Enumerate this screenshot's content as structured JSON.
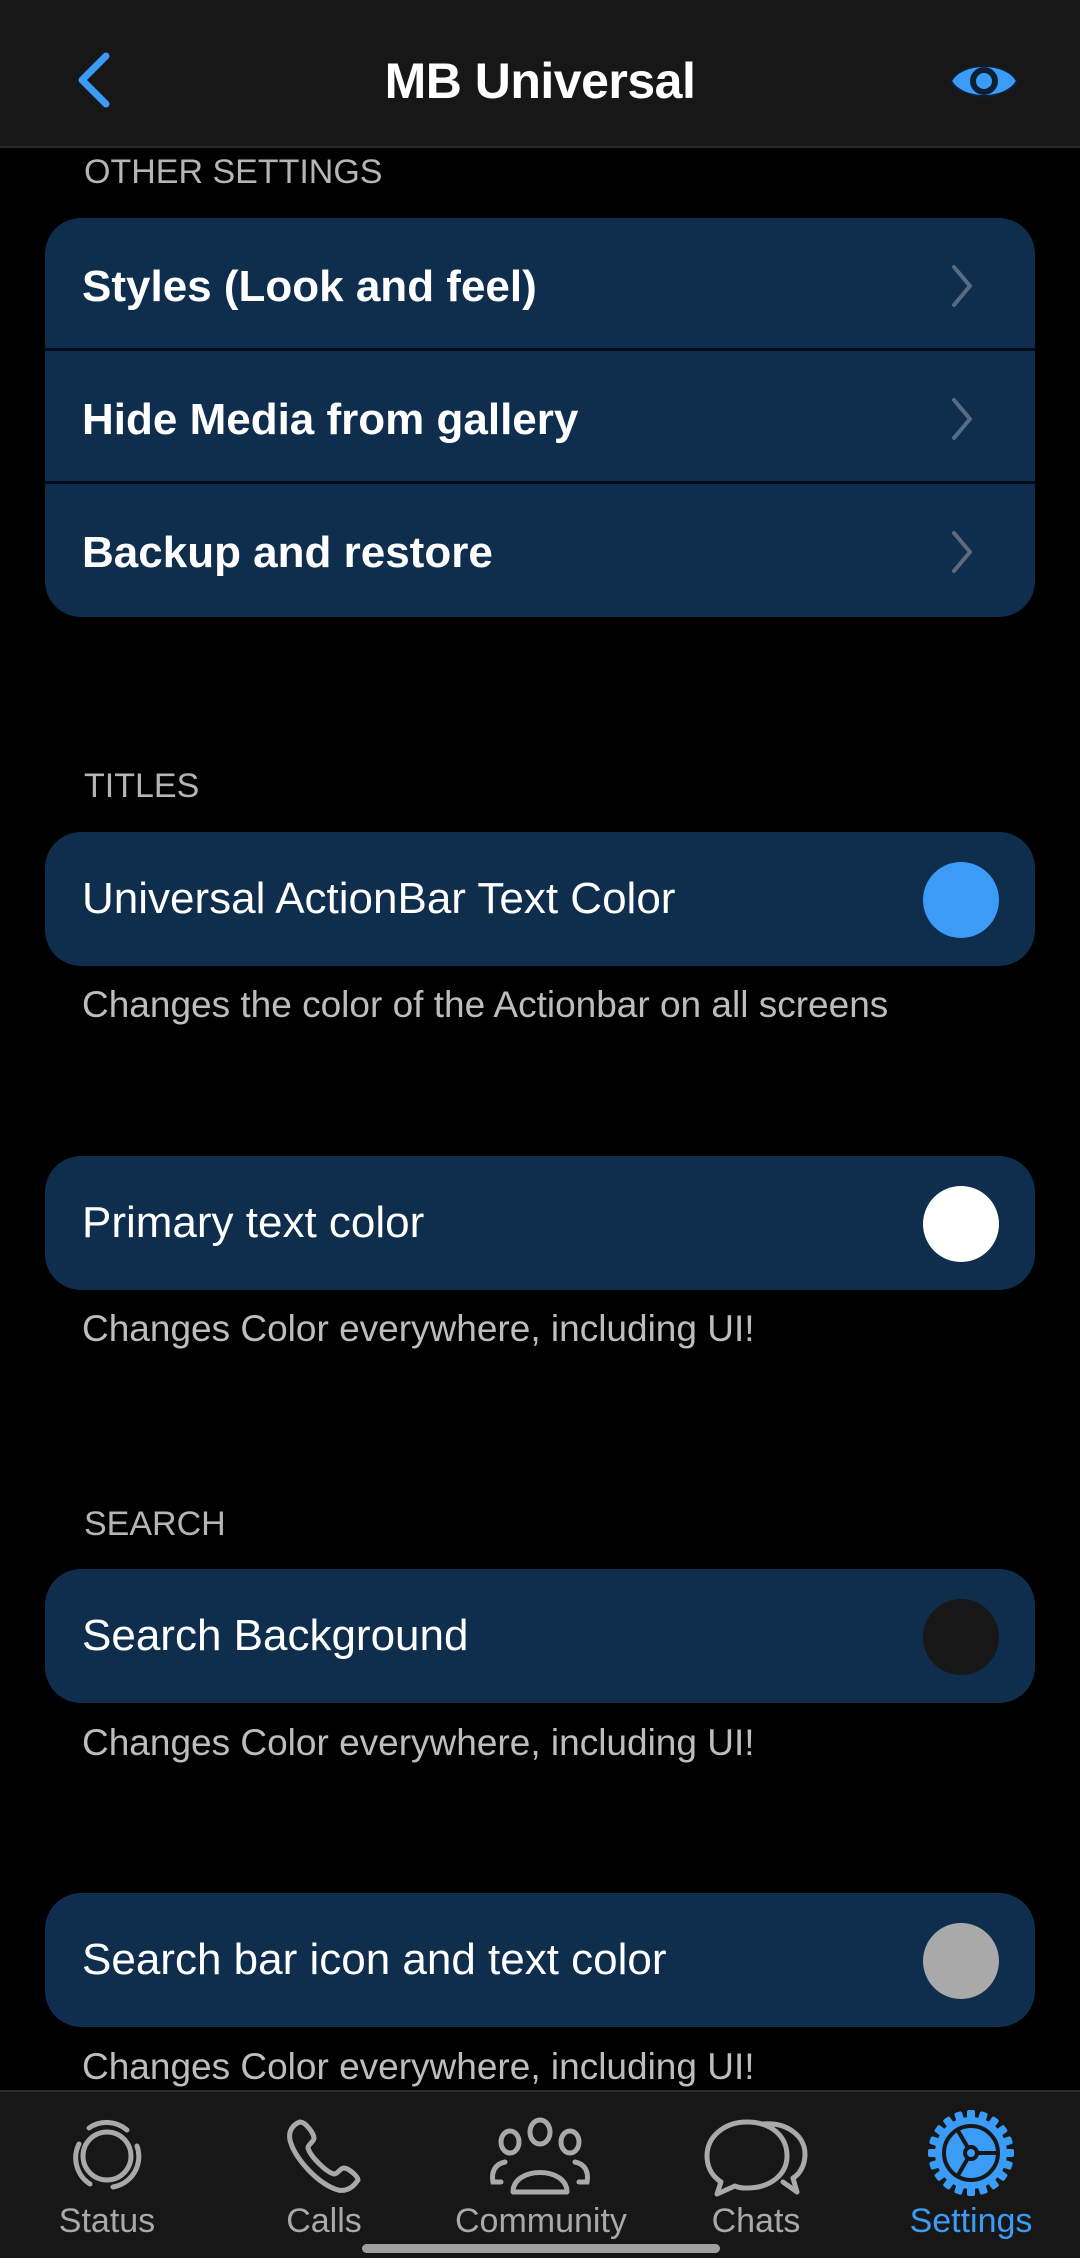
{
  "header": {
    "title": "MB Universal",
    "back_icon": "chevron-left-icon",
    "right_icon": "eye-icon",
    "accent": "#3a9cf7"
  },
  "sections": {
    "other_settings": {
      "label": "OTHER SETTINGS",
      "items": [
        {
          "label": "Styles (Look and feel)",
          "icon": "chevron-right-icon"
        },
        {
          "label": "Hide Media from gallery",
          "icon": "chevron-right-icon"
        },
        {
          "label": "Backup and restore",
          "icon": "chevron-right-icon"
        }
      ]
    },
    "titles": {
      "label": "TITLES",
      "items": [
        {
          "label": "Universal ActionBar Text Color",
          "color": "#3a9cf7",
          "description": "Changes the color of the Actionbar on all screens"
        },
        {
          "label": "Primary text color",
          "color": "#ffffff",
          "description": "Changes Color everywhere, including UI!"
        }
      ]
    },
    "search": {
      "label": "SEARCH",
      "items": [
        {
          "label": "Search Background",
          "color": "#171717",
          "description": "Changes Color everywhere, including UI!"
        },
        {
          "label": "Search bar icon and text color",
          "color": "#a9a9a9",
          "description": "Changes Color everywhere, including UI!"
        }
      ]
    }
  },
  "tabbar": {
    "tabs": [
      {
        "label": "Status",
        "icon": "status-icon",
        "active": false
      },
      {
        "label": "Calls",
        "icon": "phone-icon",
        "active": false
      },
      {
        "label": "Community",
        "icon": "community-icon",
        "active": false
      },
      {
        "label": "Chats",
        "icon": "chat-bubbles-icon",
        "active": false
      },
      {
        "label": "Settings",
        "icon": "gear-icon",
        "active": true
      }
    ]
  }
}
